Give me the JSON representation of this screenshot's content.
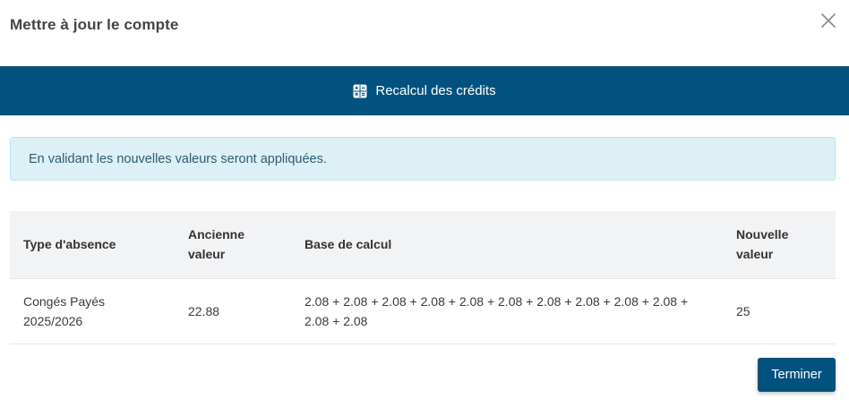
{
  "modal": {
    "title": "Mettre à jour le compte",
    "close_icon": "close-icon"
  },
  "action_bar": {
    "icon": "calculator-icon",
    "label": "Recalcul des crédits",
    "background": "#02527f"
  },
  "alert": {
    "text": "En validant les nouvelles valeurs seront appliquées."
  },
  "table": {
    "headers": {
      "type": "Type d'absence",
      "old_value": "Ancienne valeur",
      "base": "Base de calcul",
      "new_value": "Nouvelle valeur"
    },
    "rows": [
      {
        "type": "Congés Payés 2025/2026",
        "old_value": "22.88",
        "base": "2.08 + 2.08 + 2.08 + 2.08 + 2.08 + 2.08 + 2.08 + 2.08 + 2.08 + 2.08 + 2.08 + 2.08",
        "new_value": "25"
      }
    ]
  },
  "footer": {
    "finish_label": "Terminer"
  }
}
